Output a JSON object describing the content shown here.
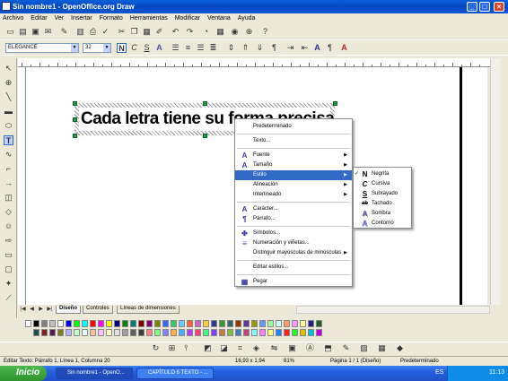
{
  "window": {
    "title": "Sin nombre1 - OpenOffice.org Draw",
    "min": "_",
    "max": "□",
    "close": "×"
  },
  "menubar": [
    "Archivo",
    "Editar",
    "Ver",
    "Insertar",
    "Formato",
    "Herramientas",
    "Modificar",
    "Ventana",
    "Ayuda"
  ],
  "formatbar": {
    "font": "ELEGANCE",
    "size": "32",
    "bold": "N",
    "italic": "C",
    "underline": "S",
    "shadow": "A"
  },
  "canvas": {
    "text": "Cada letra tiene su forma precisa"
  },
  "context_menu": [
    {
      "label": "Predeterminado",
      "icon": ""
    },
    {
      "sep": true
    },
    {
      "label": "Texto...",
      "icon": ""
    },
    {
      "sep": true
    },
    {
      "label": "Fuente",
      "icon": "font-icon",
      "sub": true
    },
    {
      "label": "Tamaño",
      "icon": "font-size-icon",
      "sub": true
    },
    {
      "label": "Estilo",
      "icon": "",
      "sub": true,
      "highlighted": true
    },
    {
      "label": "Alineación",
      "icon": "",
      "sub": true
    },
    {
      "label": "Interlineado",
      "icon": "",
      "sub": true
    },
    {
      "sep": true
    },
    {
      "label": "Carácter...",
      "icon": "character-icon"
    },
    {
      "label": "Párrafo...",
      "icon": "paragraph-icon"
    },
    {
      "sep": true
    },
    {
      "label": "Símbolos...",
      "icon": "symbols-icon"
    },
    {
      "label": "Numeración y viñetas...",
      "icon": "bullets-icon"
    },
    {
      "label": "Distinguir mayúsculas de minúsculas",
      "icon": "",
      "sub": true
    },
    {
      "sep": true
    },
    {
      "label": "Editar estilos...",
      "icon": ""
    },
    {
      "sep": true
    },
    {
      "label": "Pegar",
      "icon": "paste-icon"
    }
  ],
  "style_submenu": [
    {
      "label": "Negrita",
      "glyph": "N",
      "checked": true
    },
    {
      "label": "Cursiva",
      "glyph": "C"
    },
    {
      "label": "Subrayado",
      "glyph": "S"
    },
    {
      "label": "Tachado",
      "glyph": "ab"
    },
    {
      "label": "Sombra",
      "glyph": "A"
    },
    {
      "label": "Contorno",
      "glyph": "A"
    }
  ],
  "tabs": [
    "Diseño",
    "Controles",
    "Líneas de dimensiones"
  ],
  "status": {
    "text_pos": "Editar Texto: Párrafo 1, Línea 1, Columna 20",
    "coords": "16,93 x 1,94",
    "zoom": "81%",
    "page": "Página 1 / 1 (Diseño)",
    "style": "Predeterminado"
  },
  "taskbar": {
    "start": "Inicio",
    "items": [
      "Sin nombre1 - OpenO...",
      "CAPÍTULO 6 TEXTO - ..."
    ],
    "lang": "ES",
    "clock": "11:13"
  },
  "palette_colors": [
    "#000000",
    "#808080",
    "#C0C0C0",
    "#FFFFFF",
    "#0000FF",
    "#00FF00",
    "#00FFFF",
    "#FF0000",
    "#FF00FF",
    "#FFFF00",
    "#000080",
    "#008000",
    "#008080",
    "#800000",
    "#800080",
    "#808000",
    "#3366FF",
    "#33CC66",
    "#66CCFF",
    "#FF6633",
    "#CC66CC",
    "#FFCC33",
    "#333399",
    "#339933",
    "#336666",
    "#993300",
    "#663399",
    "#999900",
    "#6699FF",
    "#99FF99",
    "#CCFFFF",
    "#FF9966",
    "#FF99FF",
    "#FFFF99",
    "#1F1F7F",
    "#1F5F1F",
    "#1F4F4F",
    "#7F1F1F",
    "#4F1F4F",
    "#7F7F1F",
    "#B0B0FF",
    "#C0FFC0",
    "#E0FFFF",
    "#FFC0A0",
    "#FFC0FF",
    "#FFFFC0",
    "#E0E0E0",
    "#A0A0A0",
    "#606060",
    "#404040",
    "#FF8080",
    "#80FF80",
    "#8080FF",
    "#FFB040",
    "#40B0FF",
    "#B040FF",
    "#FF4080",
    "#40FF80",
    "#8040FF",
    "#C08040",
    "#80C040",
    "#4080C0",
    "#C04080",
    "#80FFFF",
    "#FF80FF",
    "#FFFF80",
    "#2080FF",
    "#FF2020",
    "#20FF20",
    "#E0C000",
    "#00C0E0",
    "#C000E0"
  ]
}
